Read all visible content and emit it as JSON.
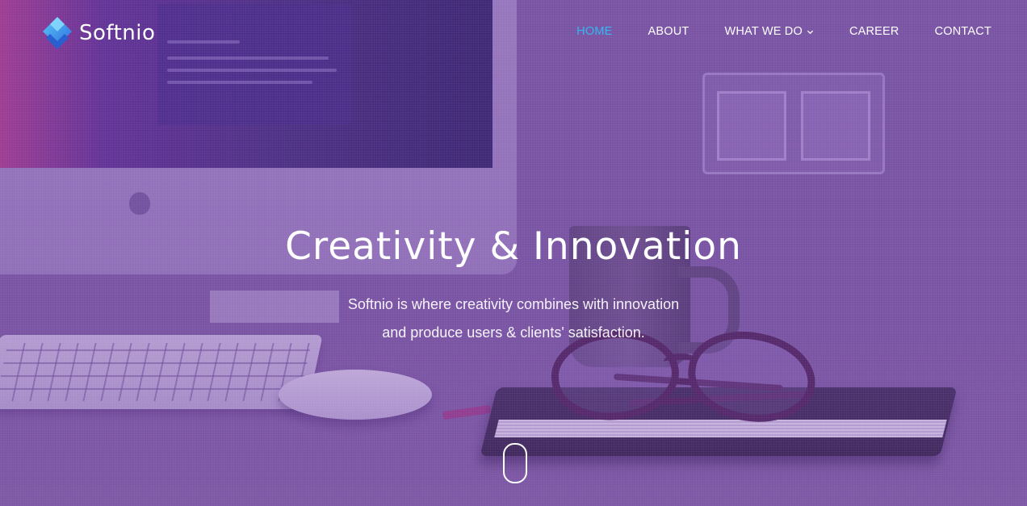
{
  "brand": {
    "name": "Softnio",
    "logo_colors": {
      "primary": "#2d8fe6",
      "secondary": "#5cc6f7"
    }
  },
  "nav": {
    "items": [
      {
        "label": "HOME",
        "active": true
      },
      {
        "label": "ABOUT",
        "active": false
      },
      {
        "label": "WHAT WE DO",
        "active": false,
        "has_dropdown": true
      },
      {
        "label": "CAREER",
        "active": false
      },
      {
        "label": "CONTACT",
        "active": false
      }
    ],
    "active_color": "#34b7f1",
    "text_color": "#ffffff"
  },
  "hero": {
    "title": "Creativity & Innovation",
    "subtitle_line1": "Softnio is where creativity combines with innovation",
    "subtitle_line2": "and produce users & clients' satisfaction.",
    "overlay_color": "#7b5aa2",
    "scroll_icon": "mouse-scroll-icon"
  }
}
